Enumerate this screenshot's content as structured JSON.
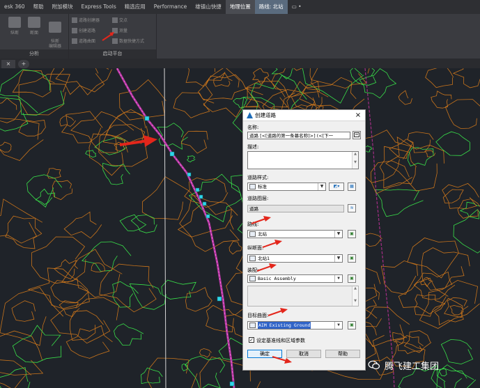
{
  "menubar": {
    "items": [
      {
        "label": "esk 360",
        "state": "normal"
      },
      {
        "label": "帮助",
        "state": "normal"
      },
      {
        "label": "附加模块",
        "state": "normal"
      },
      {
        "label": "Express Tools",
        "state": "normal"
      },
      {
        "label": "精选应用",
        "state": "normal"
      },
      {
        "label": "Performance",
        "state": "normal"
      },
      {
        "label": "雄镇山快捷",
        "state": "normal"
      },
      {
        "label": "地理位置",
        "state": "active"
      },
      {
        "label": "路线: 北站",
        "state": "context"
      },
      {
        "label": "▭ •",
        "state": "normal"
      }
    ]
  },
  "ribbon": {
    "panels": [
      {
        "title": "分析",
        "big_buttons": [
          "纵断",
          "断面",
          "纵断\n编辑器"
        ]
      },
      {
        "title": "启动平台",
        "small_buttons": [
          "道路创建器",
          "创建道路",
          "道路曲面",
          "交点",
          "测量",
          "数据快捷方式"
        ]
      }
    ]
  },
  "tabs": {
    "close_glyph": "×",
    "add_glyph": "+"
  },
  "dialog": {
    "title": "创建道路",
    "close_glyph": "×",
    "name_label": "名称:",
    "name_value": "道路 [<[道路的第一条幕名称]>] (<[下一",
    "description_label": "描述:",
    "description_value": "",
    "corridor_style_label": "道路样式:",
    "corridor_style_value": "标准",
    "corridor_layer_label": "道路图层:",
    "corridor_layer_value": "道路",
    "alignment_label": "路线:",
    "alignment_value": "北站",
    "profile_label": "纵断面:",
    "profile_value": "北站1",
    "assembly_label": "装配:",
    "assembly_value": "Basic Assembly",
    "target_surface_label": "目标曲面:",
    "target_surface_value": "AIM Existing Ground",
    "baseline_checkbox_label": "设定基准线和区域参数",
    "baseline_checked": true,
    "ok_label": "确定",
    "cancel_label": "取消",
    "help_label": "帮助"
  },
  "watermark": {
    "text": "腾飞建工集团"
  },
  "colors": {
    "canvas_bg": "#1f2329",
    "contour_orange": "#c8741c",
    "contour_green": "#39e04a",
    "alignment_magenta": "#b0359f",
    "annotation_red": "#e3261b",
    "grip_cyan": "#2fd6e8"
  }
}
